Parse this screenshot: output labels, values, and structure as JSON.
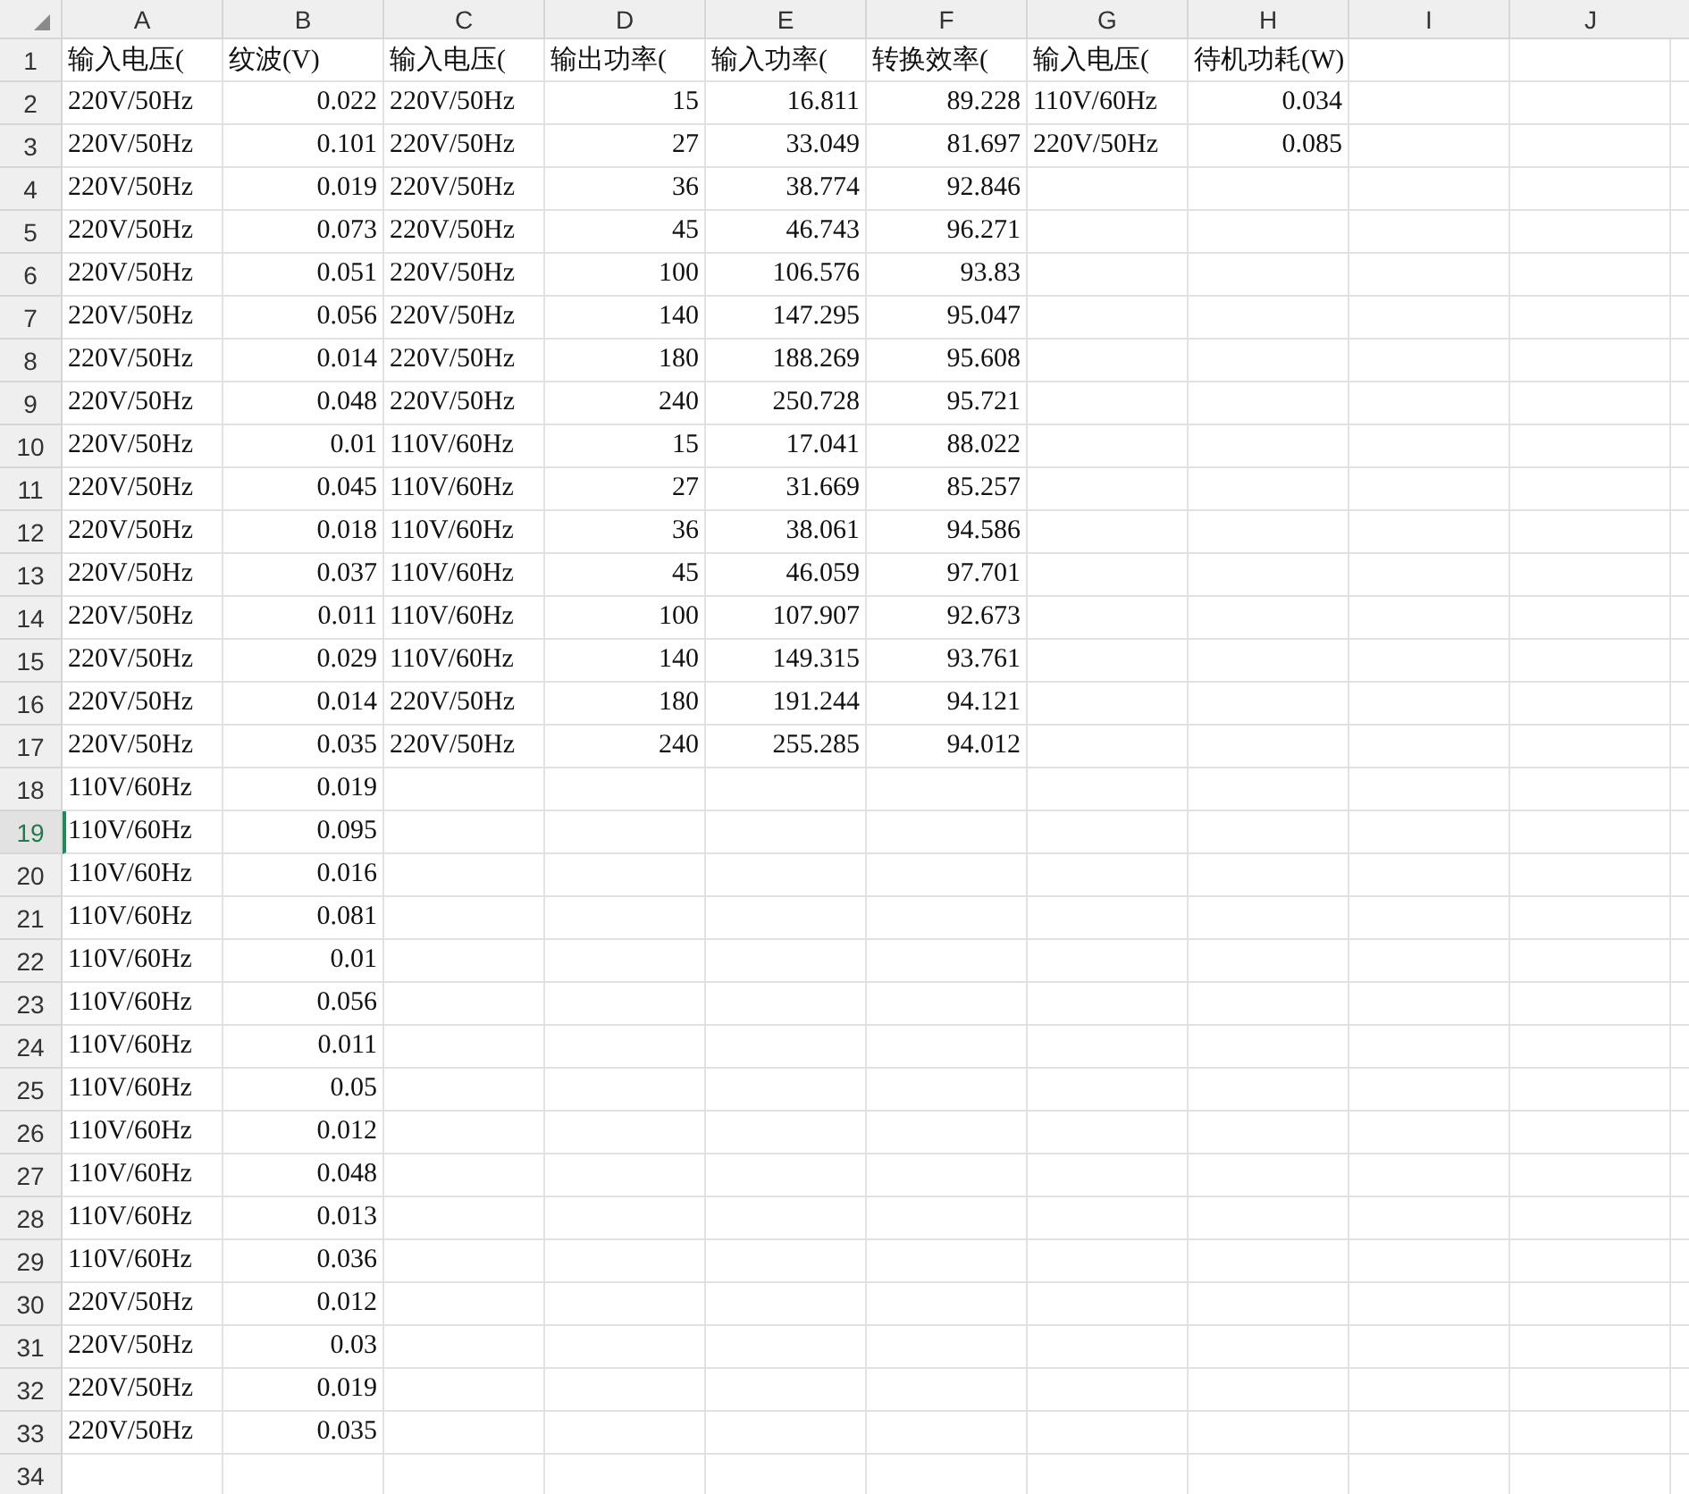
{
  "columns": [
    "A",
    "B",
    "C",
    "D",
    "E",
    "F",
    "G",
    "H",
    "I",
    "J"
  ],
  "rows": [
    {
      "number": "1",
      "selected": false,
      "cells": {
        "A": {
          "value": "输入电压(",
          "kind": "text"
        },
        "B": {
          "value": "纹波(V)",
          "kind": "text"
        },
        "C": {
          "value": "输入电压(",
          "kind": "text"
        },
        "D": {
          "value": "输出功率(",
          "kind": "text"
        },
        "E": {
          "value": "输入功率(",
          "kind": "text"
        },
        "F": {
          "value": "转换效率(",
          "kind": "text"
        },
        "G": {
          "value": "输入电压(",
          "kind": "text"
        },
        "H": {
          "value": "待机功耗(W)",
          "kind": "text"
        }
      }
    },
    {
      "number": "2",
      "selected": false,
      "cells": {
        "A": {
          "value": "220V/50Hz",
          "kind": "text"
        },
        "B": {
          "value": "0.022",
          "kind": "number"
        },
        "C": {
          "value": "220V/50Hz",
          "kind": "text"
        },
        "D": {
          "value": "15",
          "kind": "number"
        },
        "E": {
          "value": "16.811",
          "kind": "number"
        },
        "F": {
          "value": "89.228",
          "kind": "number"
        },
        "G": {
          "value": "110V/60Hz",
          "kind": "text"
        },
        "H": {
          "value": "0.034",
          "kind": "number"
        }
      }
    },
    {
      "number": "3",
      "selected": false,
      "cells": {
        "A": {
          "value": "220V/50Hz",
          "kind": "text"
        },
        "B": {
          "value": "0.101",
          "kind": "number"
        },
        "C": {
          "value": "220V/50Hz",
          "kind": "text"
        },
        "D": {
          "value": "27",
          "kind": "number"
        },
        "E": {
          "value": "33.049",
          "kind": "number"
        },
        "F": {
          "value": "81.697",
          "kind": "number"
        },
        "G": {
          "value": "220V/50Hz",
          "kind": "text"
        },
        "H": {
          "value": "0.085",
          "kind": "number"
        }
      }
    },
    {
      "number": "4",
      "selected": false,
      "cells": {
        "A": {
          "value": "220V/50Hz",
          "kind": "text"
        },
        "B": {
          "value": "0.019",
          "kind": "number"
        },
        "C": {
          "value": "220V/50Hz",
          "kind": "text"
        },
        "D": {
          "value": "36",
          "kind": "number"
        },
        "E": {
          "value": "38.774",
          "kind": "number"
        },
        "F": {
          "value": "92.846",
          "kind": "number"
        }
      }
    },
    {
      "number": "5",
      "selected": false,
      "cells": {
        "A": {
          "value": "220V/50Hz",
          "kind": "text"
        },
        "B": {
          "value": "0.073",
          "kind": "number"
        },
        "C": {
          "value": "220V/50Hz",
          "kind": "text"
        },
        "D": {
          "value": "45",
          "kind": "number"
        },
        "E": {
          "value": "46.743",
          "kind": "number"
        },
        "F": {
          "value": "96.271",
          "kind": "number"
        }
      }
    },
    {
      "number": "6",
      "selected": false,
      "cells": {
        "A": {
          "value": "220V/50Hz",
          "kind": "text"
        },
        "B": {
          "value": "0.051",
          "kind": "number"
        },
        "C": {
          "value": "220V/50Hz",
          "kind": "text"
        },
        "D": {
          "value": "100",
          "kind": "number"
        },
        "E": {
          "value": "106.576",
          "kind": "number"
        },
        "F": {
          "value": "93.83",
          "kind": "number"
        }
      }
    },
    {
      "number": "7",
      "selected": false,
      "cells": {
        "A": {
          "value": "220V/50Hz",
          "kind": "text"
        },
        "B": {
          "value": "0.056",
          "kind": "number"
        },
        "C": {
          "value": "220V/50Hz",
          "kind": "text"
        },
        "D": {
          "value": "140",
          "kind": "number"
        },
        "E": {
          "value": "147.295",
          "kind": "number"
        },
        "F": {
          "value": "95.047",
          "kind": "number"
        }
      }
    },
    {
      "number": "8",
      "selected": false,
      "cells": {
        "A": {
          "value": "220V/50Hz",
          "kind": "text"
        },
        "B": {
          "value": "0.014",
          "kind": "number"
        },
        "C": {
          "value": "220V/50Hz",
          "kind": "text"
        },
        "D": {
          "value": "180",
          "kind": "number"
        },
        "E": {
          "value": "188.269",
          "kind": "number"
        },
        "F": {
          "value": "95.608",
          "kind": "number"
        }
      }
    },
    {
      "number": "9",
      "selected": false,
      "cells": {
        "A": {
          "value": "220V/50Hz",
          "kind": "text"
        },
        "B": {
          "value": "0.048",
          "kind": "number"
        },
        "C": {
          "value": "220V/50Hz",
          "kind": "text"
        },
        "D": {
          "value": "240",
          "kind": "number"
        },
        "E": {
          "value": "250.728",
          "kind": "number"
        },
        "F": {
          "value": "95.721",
          "kind": "number"
        }
      }
    },
    {
      "number": "10",
      "selected": false,
      "cells": {
        "A": {
          "value": "220V/50Hz",
          "kind": "text"
        },
        "B": {
          "value": "0.01",
          "kind": "number"
        },
        "C": {
          "value": "110V/60Hz",
          "kind": "text"
        },
        "D": {
          "value": "15",
          "kind": "number"
        },
        "E": {
          "value": "17.041",
          "kind": "number"
        },
        "F": {
          "value": "88.022",
          "kind": "number"
        }
      }
    },
    {
      "number": "11",
      "selected": false,
      "cells": {
        "A": {
          "value": "220V/50Hz",
          "kind": "text"
        },
        "B": {
          "value": "0.045",
          "kind": "number"
        },
        "C": {
          "value": "110V/60Hz",
          "kind": "text"
        },
        "D": {
          "value": "27",
          "kind": "number"
        },
        "E": {
          "value": "31.669",
          "kind": "number"
        },
        "F": {
          "value": "85.257",
          "kind": "number"
        }
      }
    },
    {
      "number": "12",
      "selected": false,
      "cells": {
        "A": {
          "value": "220V/50Hz",
          "kind": "text"
        },
        "B": {
          "value": "0.018",
          "kind": "number"
        },
        "C": {
          "value": "110V/60Hz",
          "kind": "text"
        },
        "D": {
          "value": "36",
          "kind": "number"
        },
        "E": {
          "value": "38.061",
          "kind": "number"
        },
        "F": {
          "value": "94.586",
          "kind": "number"
        }
      }
    },
    {
      "number": "13",
      "selected": false,
      "cells": {
        "A": {
          "value": "220V/50Hz",
          "kind": "text"
        },
        "B": {
          "value": "0.037",
          "kind": "number"
        },
        "C": {
          "value": "110V/60Hz",
          "kind": "text"
        },
        "D": {
          "value": "45",
          "kind": "number"
        },
        "E": {
          "value": "46.059",
          "kind": "number"
        },
        "F": {
          "value": "97.701",
          "kind": "number"
        }
      }
    },
    {
      "number": "14",
      "selected": false,
      "cells": {
        "A": {
          "value": "220V/50Hz",
          "kind": "text"
        },
        "B": {
          "value": "0.011",
          "kind": "number"
        },
        "C": {
          "value": "110V/60Hz",
          "kind": "text"
        },
        "D": {
          "value": "100",
          "kind": "number"
        },
        "E": {
          "value": "107.907",
          "kind": "number"
        },
        "F": {
          "value": "92.673",
          "kind": "number"
        }
      }
    },
    {
      "number": "15",
      "selected": false,
      "cells": {
        "A": {
          "value": "220V/50Hz",
          "kind": "text"
        },
        "B": {
          "value": "0.029",
          "kind": "number"
        },
        "C": {
          "value": "110V/60Hz",
          "kind": "text"
        },
        "D": {
          "value": "140",
          "kind": "number"
        },
        "E": {
          "value": "149.315",
          "kind": "number"
        },
        "F": {
          "value": "93.761",
          "kind": "number"
        }
      }
    },
    {
      "number": "16",
      "selected": false,
      "cells": {
        "A": {
          "value": "220V/50Hz",
          "kind": "text"
        },
        "B": {
          "value": "0.014",
          "kind": "number"
        },
        "C": {
          "value": "220V/50Hz",
          "kind": "text"
        },
        "D": {
          "value": "180",
          "kind": "number"
        },
        "E": {
          "value": "191.244",
          "kind": "number"
        },
        "F": {
          "value": "94.121",
          "kind": "number"
        }
      }
    },
    {
      "number": "17",
      "selected": false,
      "cells": {
        "A": {
          "value": "220V/50Hz",
          "kind": "text"
        },
        "B": {
          "value": "0.035",
          "kind": "number"
        },
        "C": {
          "value": "220V/50Hz",
          "kind": "text"
        },
        "D": {
          "value": "240",
          "kind": "number"
        },
        "E": {
          "value": "255.285",
          "kind": "number"
        },
        "F": {
          "value": "94.012",
          "kind": "number"
        }
      }
    },
    {
      "number": "18",
      "selected": false,
      "cells": {
        "A": {
          "value": "110V/60Hz",
          "kind": "text"
        },
        "B": {
          "value": "0.019",
          "kind": "number"
        }
      }
    },
    {
      "number": "19",
      "selected": true,
      "cells": {
        "A": {
          "value": "110V/60Hz",
          "kind": "text"
        },
        "B": {
          "value": "0.095",
          "kind": "number"
        }
      }
    },
    {
      "number": "20",
      "selected": false,
      "cells": {
        "A": {
          "value": "110V/60Hz",
          "kind": "text"
        },
        "B": {
          "value": "0.016",
          "kind": "number"
        }
      }
    },
    {
      "number": "21",
      "selected": false,
      "cells": {
        "A": {
          "value": "110V/60Hz",
          "kind": "text"
        },
        "B": {
          "value": "0.081",
          "kind": "number"
        }
      }
    },
    {
      "number": "22",
      "selected": false,
      "cells": {
        "A": {
          "value": "110V/60Hz",
          "kind": "text"
        },
        "B": {
          "value": "0.01",
          "kind": "number"
        }
      }
    },
    {
      "number": "23",
      "selected": false,
      "cells": {
        "A": {
          "value": "110V/60Hz",
          "kind": "text"
        },
        "B": {
          "value": "0.056",
          "kind": "number"
        }
      }
    },
    {
      "number": "24",
      "selected": false,
      "cells": {
        "A": {
          "value": "110V/60Hz",
          "kind": "text"
        },
        "B": {
          "value": "0.011",
          "kind": "number"
        }
      }
    },
    {
      "number": "25",
      "selected": false,
      "cells": {
        "A": {
          "value": "110V/60Hz",
          "kind": "text"
        },
        "B": {
          "value": "0.05",
          "kind": "number"
        }
      }
    },
    {
      "number": "26",
      "selected": false,
      "cells": {
        "A": {
          "value": "110V/60Hz",
          "kind": "text"
        },
        "B": {
          "value": "0.012",
          "kind": "number"
        }
      }
    },
    {
      "number": "27",
      "selected": false,
      "cells": {
        "A": {
          "value": "110V/60Hz",
          "kind": "text"
        },
        "B": {
          "value": "0.048",
          "kind": "number"
        }
      }
    },
    {
      "number": "28",
      "selected": false,
      "cells": {
        "A": {
          "value": "110V/60Hz",
          "kind": "text"
        },
        "B": {
          "value": "0.013",
          "kind": "number"
        }
      }
    },
    {
      "number": "29",
      "selected": false,
      "cells": {
        "A": {
          "value": "110V/60Hz",
          "kind": "text"
        },
        "B": {
          "value": "0.036",
          "kind": "number"
        }
      }
    },
    {
      "number": "30",
      "selected": false,
      "cells": {
        "A": {
          "value": "220V/50Hz",
          "kind": "text"
        },
        "B": {
          "value": "0.012",
          "kind": "number"
        }
      }
    },
    {
      "number": "31",
      "selected": false,
      "cells": {
        "A": {
          "value": "220V/50Hz",
          "kind": "text"
        },
        "B": {
          "value": "0.03",
          "kind": "number"
        }
      }
    },
    {
      "number": "32",
      "selected": false,
      "cells": {
        "A": {
          "value": "220V/50Hz",
          "kind": "text"
        },
        "B": {
          "value": "0.019",
          "kind": "number"
        }
      }
    },
    {
      "number": "33",
      "selected": false,
      "cells": {
        "A": {
          "value": "220V/50Hz",
          "kind": "text"
        },
        "B": {
          "value": "0.035",
          "kind": "number"
        }
      }
    },
    {
      "number": "34",
      "selected": false
    }
  ]
}
